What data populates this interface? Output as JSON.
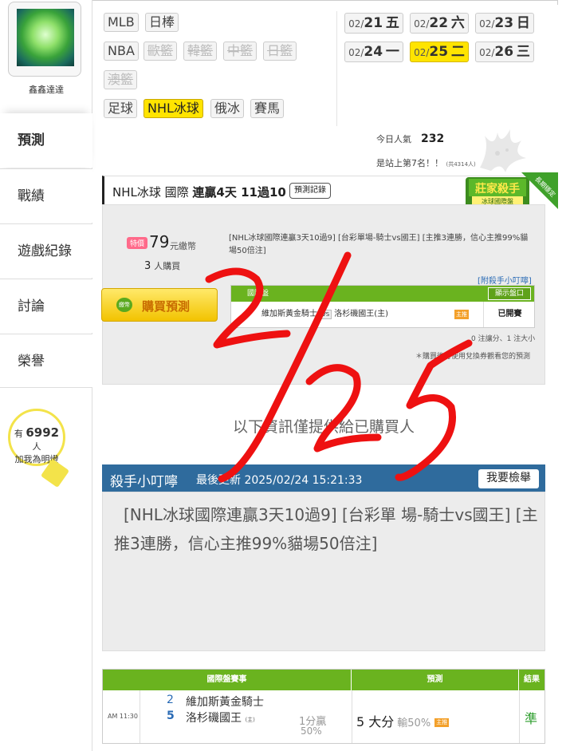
{
  "user": {
    "name": "鑫鑫達達"
  },
  "nav": [
    {
      "label": "預測"
    },
    {
      "label": "戰績"
    },
    {
      "label": "遊戲紀錄"
    },
    {
      "label": "討論"
    },
    {
      "label": "榮譽"
    }
  ],
  "lights": {
    "prefix": "有",
    "count": "6992",
    "suffix": "人",
    "cta": "加我為明燈"
  },
  "sports": [
    "MLB",
    "日棒",
    "NBA",
    "歐籃",
    "韓籃",
    "中籃",
    "日籃",
    "澳籃",
    "足球",
    "NHL冰球",
    "俄冰",
    "賽馬"
  ],
  "dates": [
    {
      "md": "02/",
      "day": "21",
      "wd": "五"
    },
    {
      "md": "02/",
      "day": "22",
      "wd": "六"
    },
    {
      "md": "02/",
      "day": "23",
      "wd": "日"
    },
    {
      "md": "02/",
      "day": "24",
      "wd": "一"
    },
    {
      "md": "02/",
      "day": "25",
      "wd": "二"
    },
    {
      "md": "02/",
      "day": "26",
      "wd": "三"
    }
  ],
  "popularity": {
    "today_label": "今日人氣",
    "today_value": "232",
    "rank_text": "是站上第7名！！",
    "rank_total": "(共4314人)"
  },
  "prediction": {
    "league": "NHL冰球 國際",
    "streak": "連贏4天 11過10",
    "record_btn": "預測記錄",
    "badge_title": "莊家殺手",
    "badge_sub": "冰球國際盤",
    "badge_corner": "長期穩定",
    "price_tag": "特價",
    "price": "79",
    "price_unit": "元繳幣",
    "buyers_count": "3",
    "buyers_label": "人購買",
    "summary": "[NHL冰球國際連贏3天10過9] [台彩單場-騎士vs國王] [主推3連勝，信心主推99%貓場50倍注]",
    "killer_link": "[附殺手小叮嚀]",
    "buy_btn": "購買預測",
    "buy_coin": "繳幣",
    "table_head": "國際盤",
    "show_btn": "顯示盤口",
    "home_team": "維加斯黃金騎士",
    "vs": "VS",
    "away_team": "洛杉磯國王(主)",
    "home_tag": "主推",
    "status": "已開賽",
    "note1": "0 注讓分、1 注大小",
    "note2": "＊購買後可使用兌換券觀看您的預測"
  },
  "info_msg": "以下資訊僅提供給已購買人",
  "killer": {
    "title": "殺手小叮嚀",
    "updated": "最後更新 2025/02/24 15:21:33",
    "report_btn": "我要檢舉",
    "body": "[NHL冰球國際連贏3天10過9] [台彩單 場-騎士vs國王] [主推3連勝，信心主推99%貓場50倍注]"
  },
  "results_table": {
    "headers": [
      "國際盤賽事",
      "預測",
      "結果"
    ],
    "time": "AM 11:30",
    "team1_score": "2",
    "team1": "維加斯黃金騎士",
    "team2_score": "5",
    "team2": "洛杉磯國王",
    "team2_home": "(主)",
    "line1": "1分贏",
    "line2": "50%",
    "pick": "5 大分",
    "pick_odds": "輸50%",
    "pick_tag": "主推",
    "result": "準"
  },
  "handwriting": {
    "text": "2/25",
    "color": "#ee1111"
  }
}
